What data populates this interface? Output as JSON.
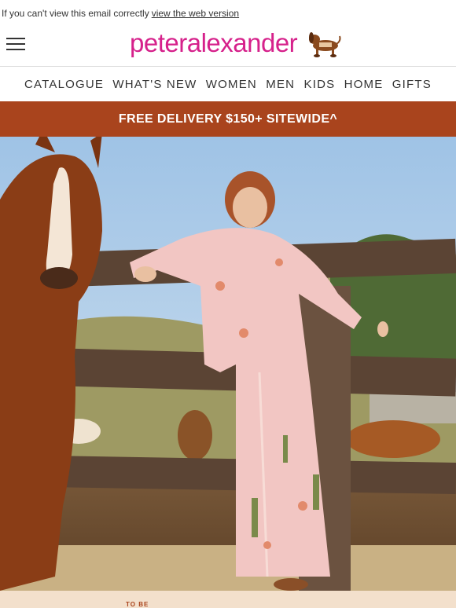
{
  "preheader": {
    "text": "If you can't view this email correctly",
    "link": "view the web version"
  },
  "header": {
    "logo": "peteralexander",
    "menu_icon": "hamburger-menu-icon",
    "mascot_icon": "dog-mascot-icon"
  },
  "nav": {
    "items": [
      "CATALOGUE",
      "WHAT'S NEW",
      "WOMEN",
      "MEN",
      "KIDS",
      "HOME",
      "GIFTS"
    ]
  },
  "promo": {
    "text": "FREE DELIVERY $150+ SITEWIDE^"
  },
  "colors": {
    "brand_pink": "#d6218b",
    "banner_rust": "#a9441d"
  },
  "footer_strip": {
    "text": "TO BE"
  }
}
